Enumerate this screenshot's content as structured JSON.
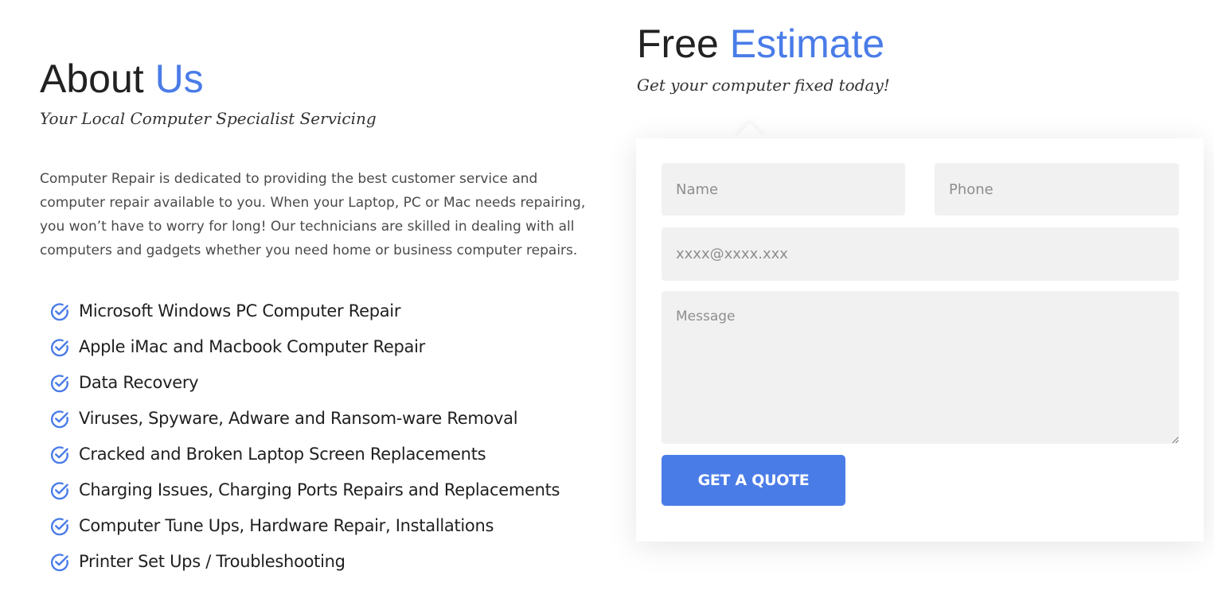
{
  "about": {
    "title_main": "About",
    "title_accent": "Us",
    "subtitle": "Your Local Computer Specialist Servicing",
    "body": "Computer Repair is dedicated to providing the best customer service and computer repair available to you. When your Laptop, PC or Mac needs repairing, you won’t have to worry for long! Our technicians are skilled in dealing with all computers and gadgets whether you need home or business computer repairs.",
    "services": [
      {
        "label": "Microsoft Windows PC Computer Repair",
        "icon": "check-circle-icon"
      },
      {
        "label": "Apple iMac and Macbook Computer Repair",
        "icon": "check-circle-icon"
      },
      {
        "label": "Data Recovery",
        "icon": "check-circle-icon"
      },
      {
        "label": "Viruses, Spyware, Adware and Ransom-ware Removal",
        "icon": "check-circle-icon"
      },
      {
        "label": "Cracked and Broken Laptop Screen Replacements",
        "icon": "check-circle-icon"
      },
      {
        "label": "Charging Issues, Charging Ports Repairs and Replacements",
        "icon": "check-circle-icon"
      },
      {
        "label": "Computer Tune Ups, Hardware Repair, Installations",
        "icon": "check-circle-icon"
      },
      {
        "label": "Printer Set Ups / Troubleshooting",
        "icon": "check-circle-icon"
      }
    ]
  },
  "estimate": {
    "title_main": "Free",
    "title_accent": "Estimate",
    "subtitle": "Get your computer fixed today!",
    "form": {
      "name_placeholder": "Name",
      "name_value": "",
      "phone_placeholder": "Phone",
      "phone_value": "",
      "email_placeholder": "xxxx@xxxx.xxx",
      "email_value": "",
      "message_placeholder": "Message",
      "message_value": "",
      "submit_label": "GET A QUOTE"
    }
  },
  "colors": {
    "accent": "#4a7ce8",
    "field_background": "#f1f1f1",
    "text_dark": "#222222"
  }
}
